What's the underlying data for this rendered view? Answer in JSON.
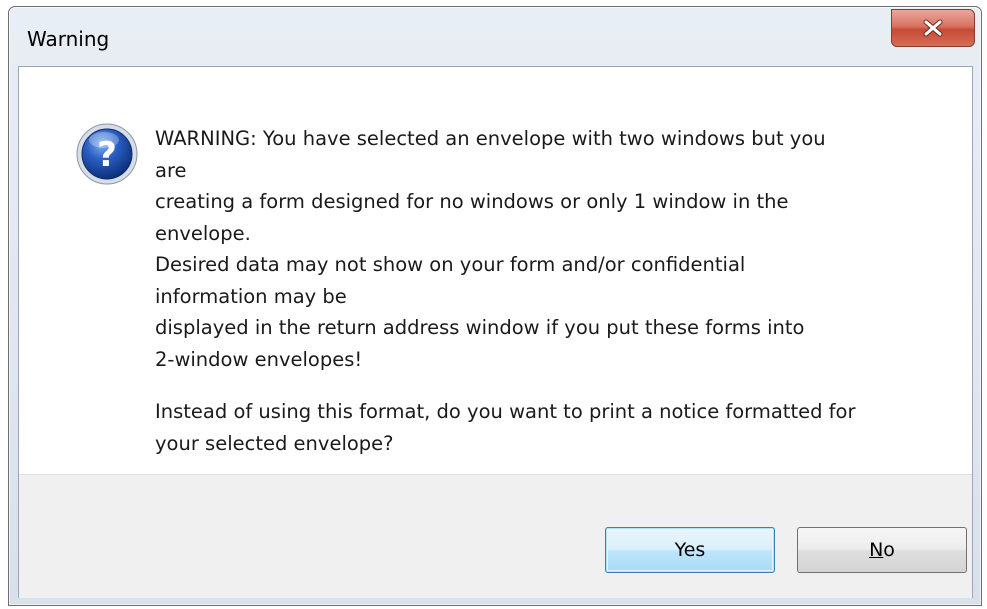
{
  "window": {
    "title": "Warning",
    "close_icon": "close-x-icon",
    "close_button_color": "#c44b36"
  },
  "message": {
    "icon": "question-icon",
    "lines": "WARNING: You have selected an envelope with two windows but you\nare\ncreating a form designed for no windows or only 1 window in the\nenvelope.\nDesired data may not show on your form and/or confidential\ninformation may be\ndisplayed in the return address window if you put these forms into\n2-window envelopes!",
    "question": "Instead of using this format, do you want to print a notice formatted for\nyour selected envelope?"
  },
  "buttons": {
    "yes_label": "Yes",
    "no_mnemonic": "N",
    "no_rest": "o"
  }
}
